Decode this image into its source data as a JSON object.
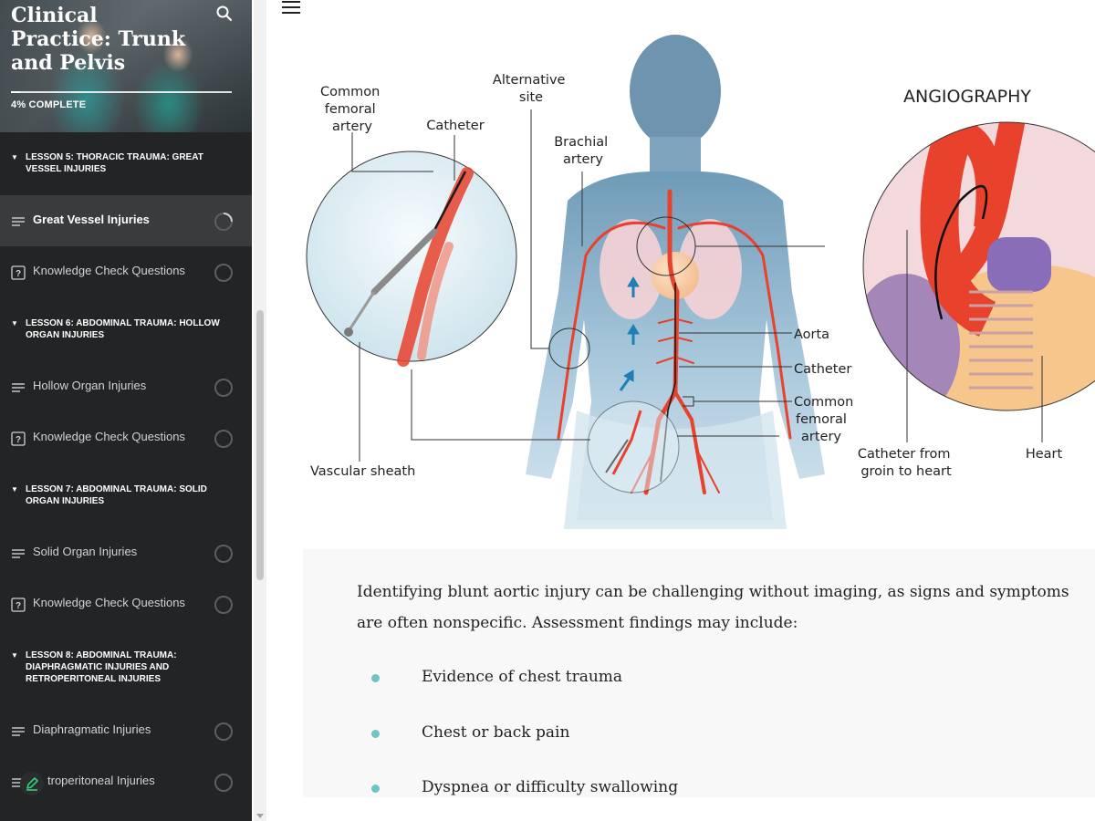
{
  "course": {
    "title": "Clinical Practice: Trunk and Pelvis",
    "progress_text": "4% COMPLETE",
    "progress_fraction": 0.04
  },
  "sidebar": {
    "lessons": [
      {
        "title": "LESSON 5: THORACIC TRAUMA: GREAT VESSEL INJURIES",
        "items": [
          {
            "label": "Great Vessel Injuries",
            "icon": "text-lines-icon",
            "status": "in-progress",
            "active": true
          },
          {
            "label": "Knowledge Check Questions",
            "icon": "question-box-icon",
            "status": "not-started"
          }
        ]
      },
      {
        "title": "LESSON 6: ABDOMINAL TRAUMA: HOLLOW ORGAN INJURIES",
        "items": [
          {
            "label": "Hollow Organ Injuries",
            "icon": "text-lines-icon",
            "status": "not-started"
          },
          {
            "label": "Knowledge Check Questions",
            "icon": "question-box-icon",
            "status": "not-started"
          }
        ]
      },
      {
        "title": "LESSON 7: ABDOMINAL TRAUMA: SOLID ORGAN INJURIES",
        "items": [
          {
            "label": "Solid Organ Injuries",
            "icon": "text-lines-icon",
            "status": "not-started"
          },
          {
            "label": "Knowledge Check Questions",
            "icon": "question-box-icon",
            "status": "not-started"
          }
        ]
      },
      {
        "title": "LESSON 8: ABDOMINAL TRAUMA: DIAPHRAGMATIC INJURIES AND RETROPERITONEAL INJURIES",
        "items": [
          {
            "label": "Diaphragmatic Injuries",
            "icon": "text-lines-icon",
            "status": "not-started"
          },
          {
            "label": "troperitoneal Injuries",
            "icon": "text-lines-icon",
            "status": "not-started"
          }
        ]
      }
    ]
  },
  "figure": {
    "labels": {
      "common_femoral_artery_left": "Common femoral artery",
      "catheter_left": "Catheter",
      "alternative_site": "Alternative site",
      "brachial_artery": "Brachial artery",
      "angiography": "ANGIOGRAPHY",
      "aorta": "Aorta",
      "catheter_right": "Catheter",
      "common_femoral_artery_right": "Common femoral artery",
      "vascular_sheath": "Vascular sheath",
      "catheter_from_groin": "Catheter from groin to heart",
      "heart": "Heart"
    }
  },
  "article": {
    "intro": "Identifying blunt aortic injury can be challenging without imaging, as signs and symptoms are often nonspecific. Assessment findings may include:",
    "bullets": [
      "Evidence of chest trauma",
      "Chest or back pain",
      "Dyspnea or difficulty swallowing"
    ]
  },
  "colors": {
    "sidebar_bg": "#232425",
    "active_item_bg": "#3a3b3c",
    "bullet_accent": "#6cc3c8",
    "artery_red": "#e8412c"
  }
}
